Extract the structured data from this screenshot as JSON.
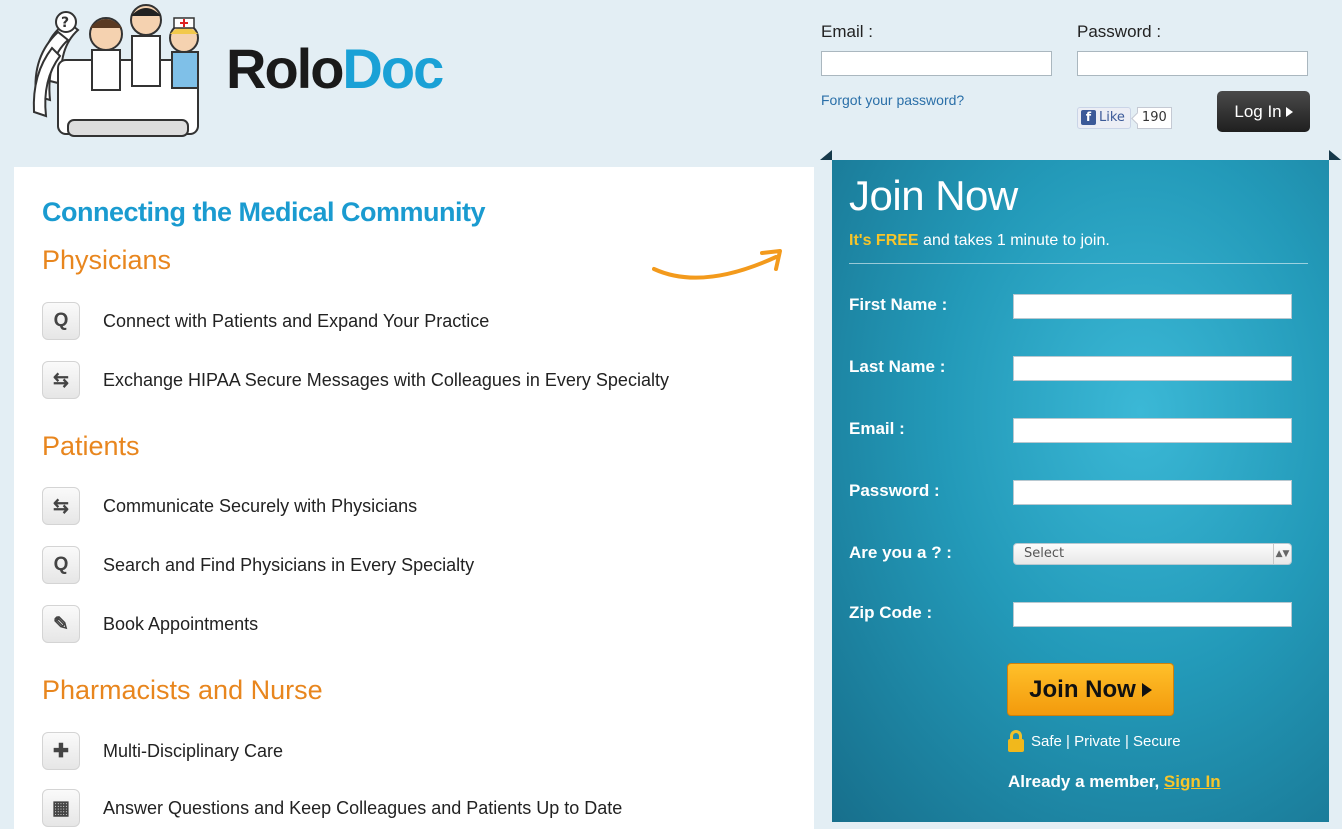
{
  "logo": {
    "part1": "Rolo",
    "part2": "Doc"
  },
  "login": {
    "email_label": "Email  :",
    "password_label": "Password  :",
    "email_value": "",
    "password_value": "",
    "forgot_link": "Forgot your password?",
    "fb_like": "Like",
    "fb_count": "190",
    "login_button": "Log In"
  },
  "main": {
    "tagline": "Connecting the Medical Community",
    "sections": [
      {
        "title": "Physicians",
        "items": [
          {
            "icon": "search-icon",
            "text": "Connect with Patients and Expand Your Practice"
          },
          {
            "icon": "exchange-icon",
            "text": "Exchange HIPAA Secure Messages with Colleagues in Every Specialty"
          }
        ]
      },
      {
        "title": "Patients",
        "items": [
          {
            "icon": "exchange-icon",
            "text": "Communicate Securely with Physicians"
          },
          {
            "icon": "search-icon",
            "text": "Search and Find Physicians in Every Specialty"
          },
          {
            "icon": "edit-icon",
            "text": "Book Appointments"
          }
        ]
      },
      {
        "title": "Pharmacists and Nurse",
        "items": [
          {
            "icon": "nurse-icon",
            "text": "Multi-Disciplinary Care"
          },
          {
            "icon": "calendar-icon",
            "text": "Answer Questions and Keep Colleagues and Patients Up to Date"
          }
        ]
      }
    ]
  },
  "join": {
    "title": "Join Now",
    "sub_free": "It's FREE",
    "sub_rest": " and takes 1 minute to join.",
    "fields": [
      {
        "label": "First Name  :",
        "value": ""
      },
      {
        "label": "Last Name  :",
        "value": ""
      },
      {
        "label": "Email  :",
        "value": ""
      },
      {
        "label": "Password  :",
        "value": ""
      },
      {
        "label": "Are you a ?  :",
        "value": "Select"
      },
      {
        "label": "Zip Code  :",
        "value": ""
      }
    ],
    "button": "Join Now",
    "secure_text": "Safe | Private | Secure",
    "member_text": "Already a member, ",
    "signin_link": "Sign In"
  },
  "colors": {
    "accent_blue": "#1aa1d6",
    "section_orange": "#e8861e",
    "free_yellow": "#f7c52a",
    "panel_teal": "#239ab9"
  }
}
